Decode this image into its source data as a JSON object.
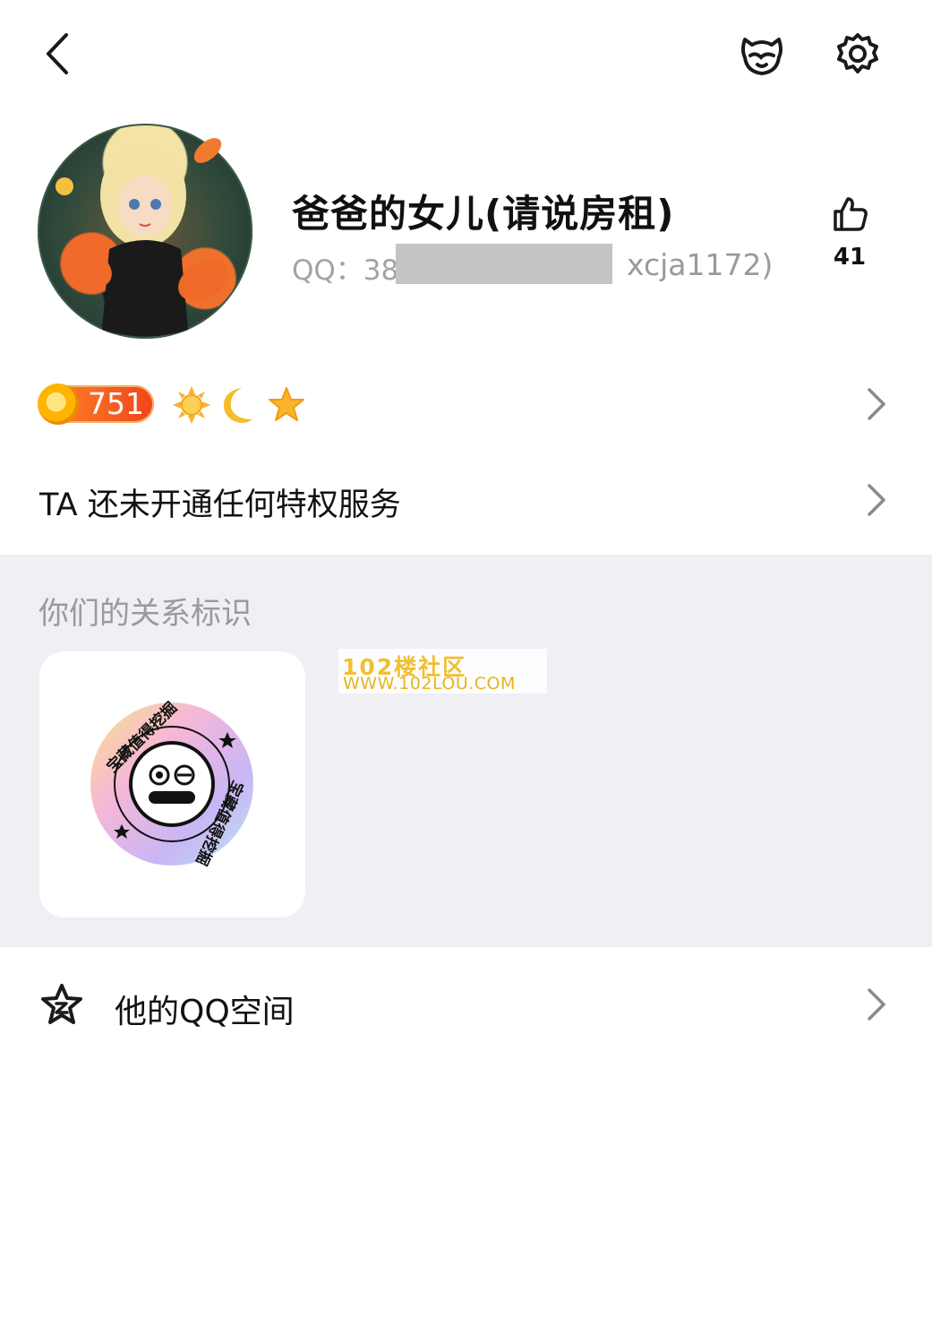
{
  "header": {
    "back_icon": "chevron-left-icon",
    "pet_icon": "pet-face-icon",
    "settings_icon": "gear-icon"
  },
  "profile": {
    "nickname": "爸爸的女儿(请说房租)",
    "qq_prefix": "QQ：38",
    "qq_suffix": "xcja1172)",
    "likes": "41",
    "like_icon": "thumbs-up-icon"
  },
  "level": {
    "value": "751",
    "icons": [
      "sun-icon",
      "moon-icon",
      "star-icon"
    ]
  },
  "privilege": {
    "text": "TA 还未开通任何特权服务"
  },
  "relation": {
    "title": "你们的关系标识",
    "badge_text": "宝藏值得挖掘"
  },
  "watermark": {
    "line1": "102楼社区",
    "line2": "WWW.102LOU.COM"
  },
  "qzone": {
    "label": "他的QQ空间",
    "icon": "qzone-star-icon"
  },
  "colors": {
    "accent_orange": "#f0451c",
    "muted_gray": "#9a9a9a",
    "section_bg": "#efeff4"
  }
}
